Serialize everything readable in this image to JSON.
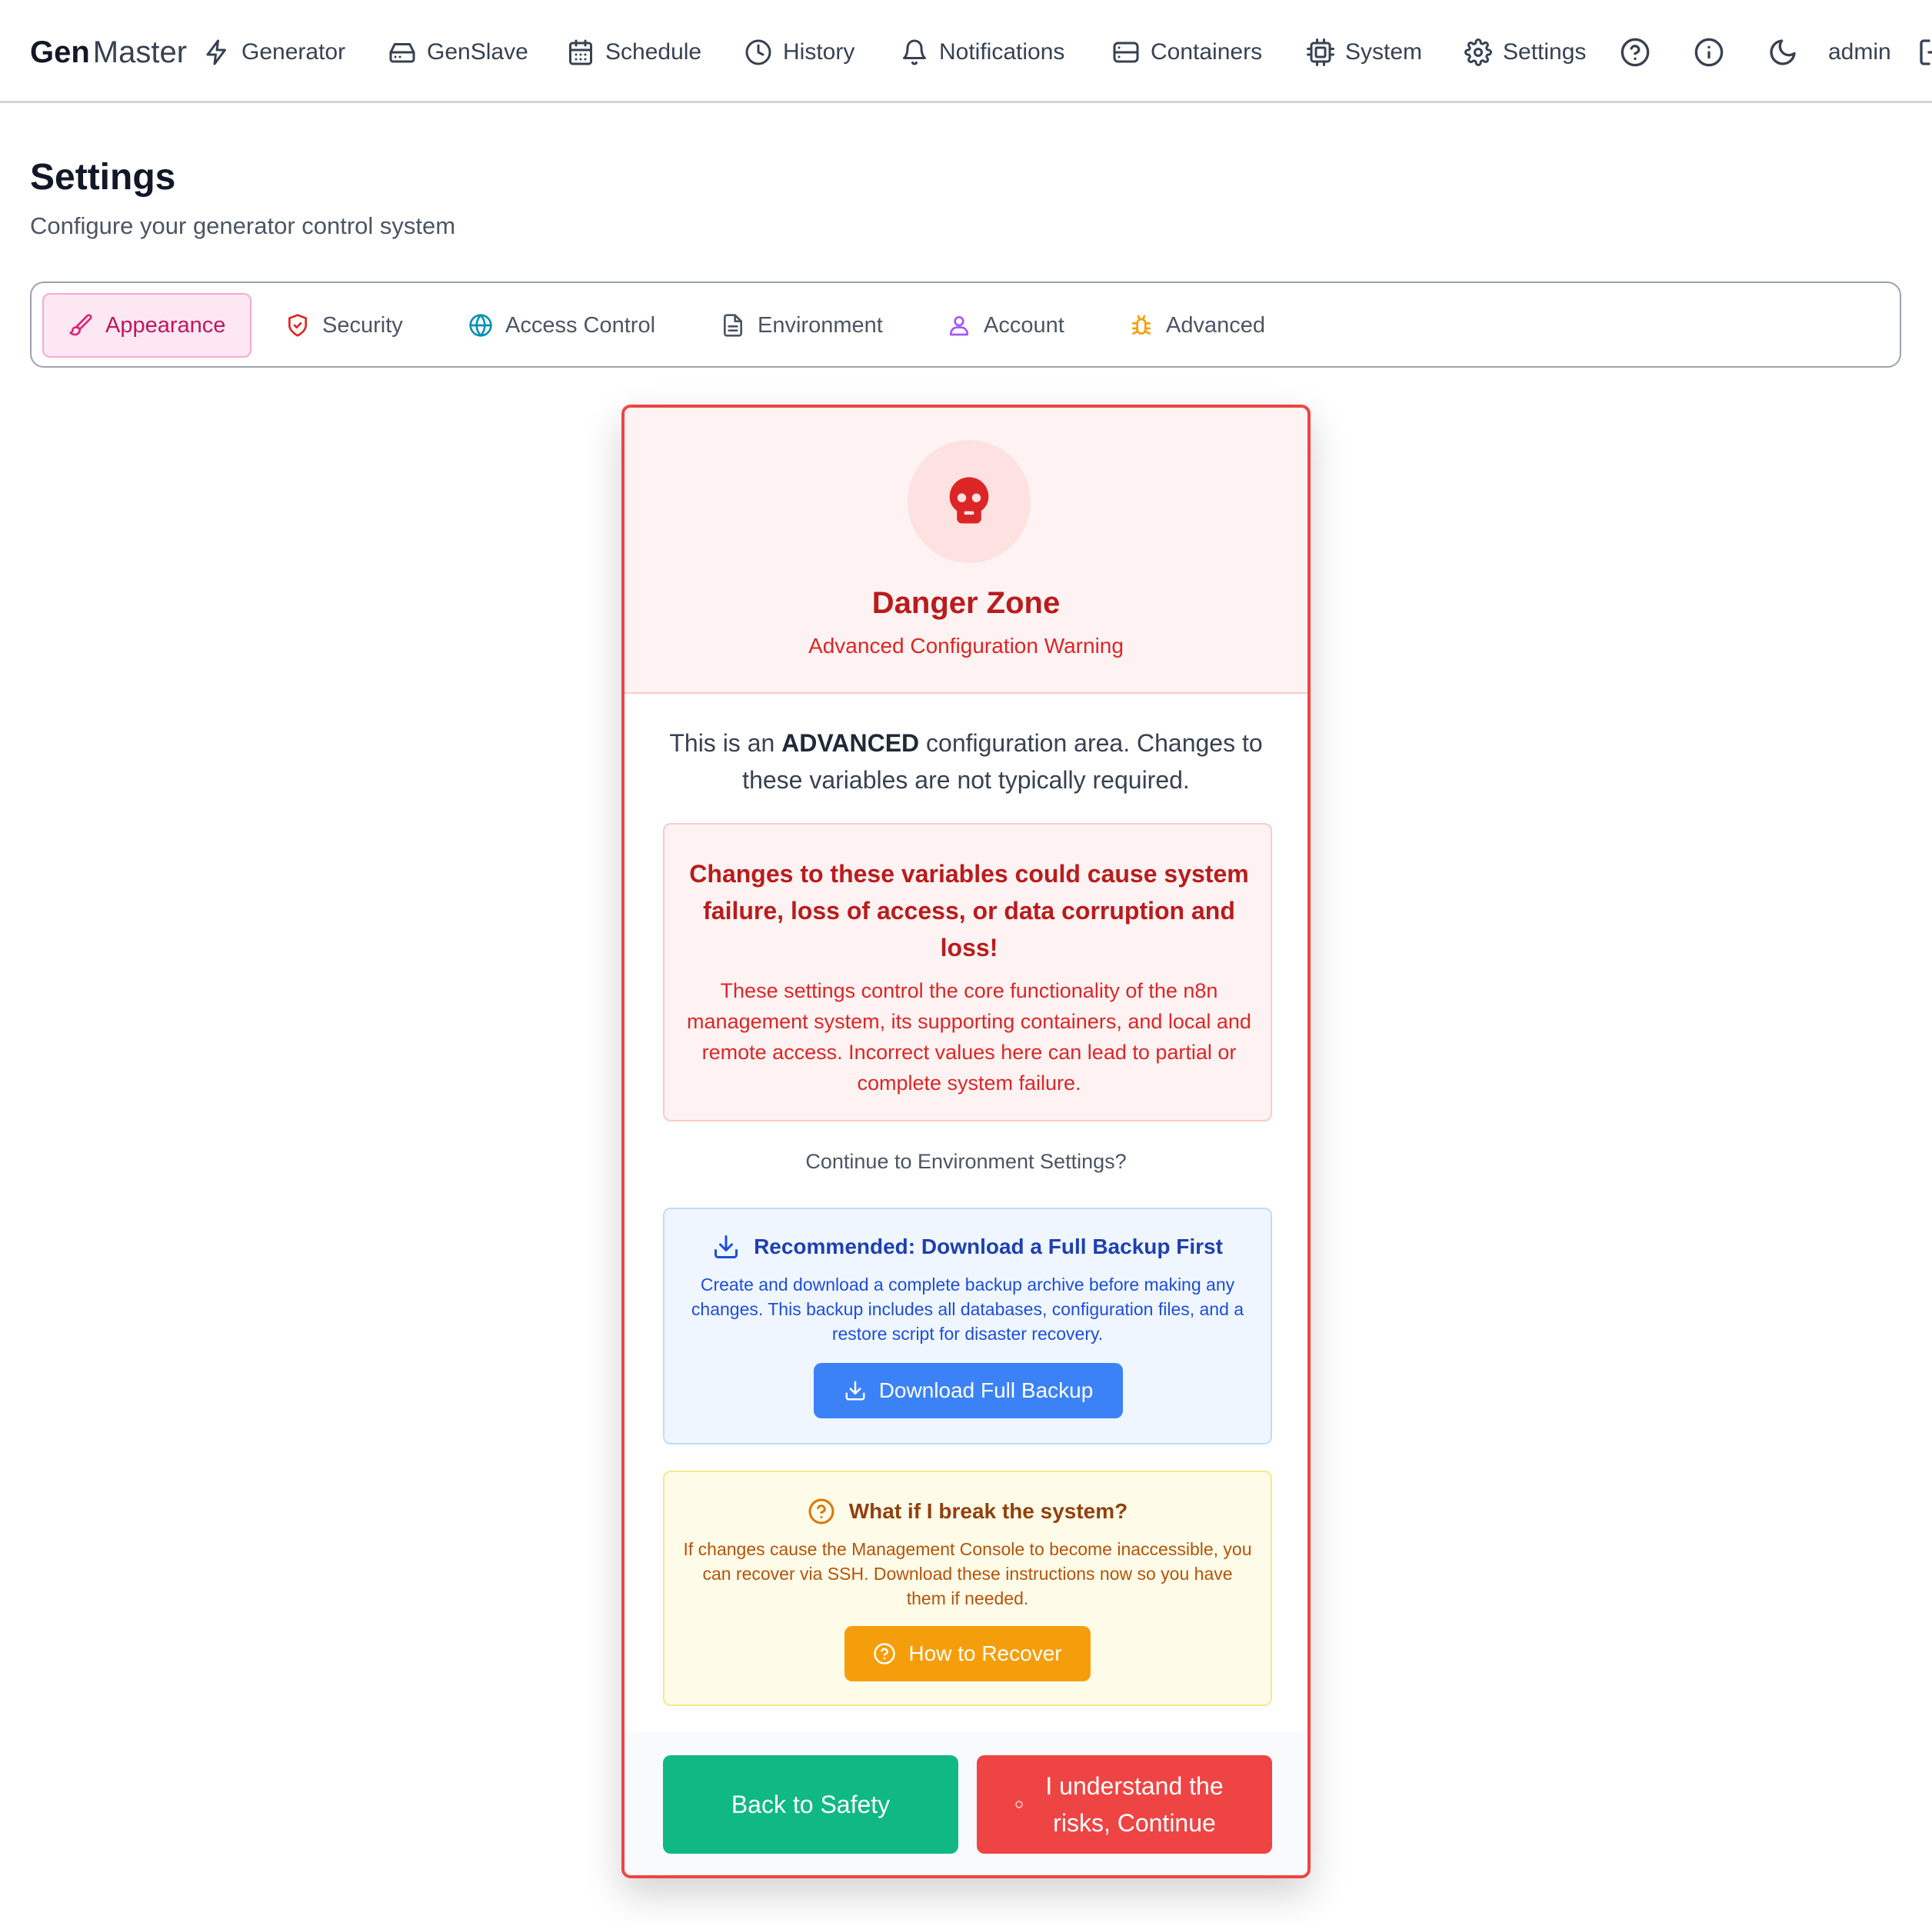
{
  "brand": {
    "part1": "Gen",
    "part2": "Master"
  },
  "nav": {
    "items": [
      {
        "label": "Generator",
        "icon": "bolt-icon"
      },
      {
        "label": "GenSlave",
        "icon": "hard-drive-icon"
      },
      {
        "label": "Schedule",
        "icon": "calendar-icon"
      },
      {
        "label": "History",
        "icon": "clock-icon"
      },
      {
        "label": "Notifications",
        "icon": "bell-icon"
      },
      {
        "label": "Containers",
        "icon": "server-icon"
      },
      {
        "label": "System",
        "icon": "cpu-icon"
      },
      {
        "label": "Settings",
        "icon": "gear-icon"
      }
    ],
    "user": "admin"
  },
  "page": {
    "title": "Settings",
    "subtitle": "Configure your generator control system"
  },
  "tabs": [
    {
      "label": "Appearance",
      "icon": "paintbrush-icon",
      "active": true,
      "color": "#be185d"
    },
    {
      "label": "Security",
      "icon": "shield-icon",
      "color": "#dc2626"
    },
    {
      "label": "Access Control",
      "icon": "globe-icon",
      "color": "#0891b2"
    },
    {
      "label": "Environment",
      "icon": "file-icon",
      "color": "#4b5563"
    },
    {
      "label": "Account",
      "icon": "user-icon",
      "color": "#a855f7"
    },
    {
      "label": "Advanced",
      "icon": "bug-icon",
      "color": "#f59e0b"
    }
  ],
  "modal": {
    "title": "Danger Zone",
    "subtitle": "Advanced Configuration Warning",
    "intro_prefix": "This is an ",
    "intro_bold": "ADVANCED",
    "intro_suffix": " configuration area. Changes to these variables are not typically required.",
    "warning_strong": "Changes to these variables could cause system failure, loss of access, or data corruption and loss!",
    "warning_body": "These settings control the core functionality of the n8n management system, its supporting containers, and local and remote access. Incorrect values here can lead to partial or complete system failure.",
    "continue_question": "Continue to Environment Settings?",
    "backup": {
      "title": "Recommended: Download a Full Backup First",
      "body": "Create and download a complete backup archive before making any changes. This backup includes all databases, configuration files, and a restore script for disaster recovery.",
      "button": "Download Full Backup"
    },
    "recover": {
      "title": "What if I break the system?",
      "body": "If changes cause the Management Console to become inaccessible, you can recover via SSH. Download these instructions now so you have them if needed.",
      "button": "How to Recover"
    },
    "back_button": "Back to Safety",
    "continue_button": "I understand the risks, Continue"
  },
  "colors": {
    "danger": "#ef4444",
    "success": "#10b981",
    "info": "#3b82f6",
    "warning": "#f59e0b",
    "active_tab": "#be185d"
  }
}
